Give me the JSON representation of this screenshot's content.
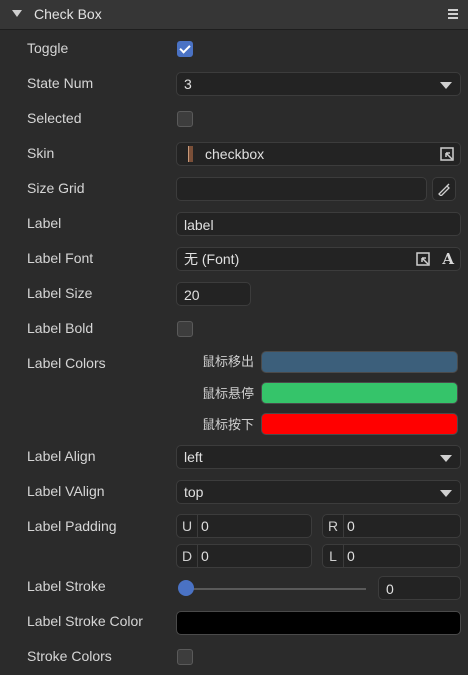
{
  "header": {
    "title": "Check Box"
  },
  "rows": {
    "toggle": {
      "label": "Toggle",
      "checked": true
    },
    "state_num": {
      "label": "State Num",
      "value": "3"
    },
    "selected": {
      "label": "Selected",
      "checked": false
    },
    "skin": {
      "label": "Skin",
      "value": "checkbox"
    },
    "size_grid": {
      "label": "Size Grid",
      "value": ""
    },
    "label_text": {
      "label": "Label",
      "value": "label"
    },
    "label_font": {
      "label": "Label Font",
      "value": "无 (Font)",
      "font_glyph": "A"
    },
    "label_size": {
      "label": "Label Size",
      "value": "20"
    },
    "label_bold": {
      "label": "Label Bold",
      "checked": false
    },
    "label_colors": {
      "label": "Label Colors",
      "items": [
        {
          "name": "鼠标移出",
          "color": "#3c5f7b"
        },
        {
          "name": "鼠标悬停",
          "color": "#35c46a"
        },
        {
          "name": "鼠标按下",
          "color": "#ff0000"
        }
      ]
    },
    "label_align": {
      "label": "Label Align",
      "value": "left"
    },
    "label_valign": {
      "label": "Label VAlign",
      "value": "top"
    },
    "label_padding": {
      "label": "Label Padding",
      "u": {
        "key": "U",
        "value": "0"
      },
      "r": {
        "key": "R",
        "value": "0"
      },
      "d": {
        "key": "D",
        "value": "0"
      },
      "l": {
        "key": "L",
        "value": "0"
      }
    },
    "label_stroke": {
      "label": "Label Stroke",
      "value": "0",
      "slider_fraction": 0
    },
    "label_stroke_color": {
      "label": "Label Stroke Color",
      "color": "#000000"
    },
    "stroke_colors": {
      "label": "Stroke Colors",
      "checked": false
    }
  },
  "colors": {
    "accent": "#4a72c4",
    "panel": "#2b2b2b",
    "field": "#232323"
  }
}
